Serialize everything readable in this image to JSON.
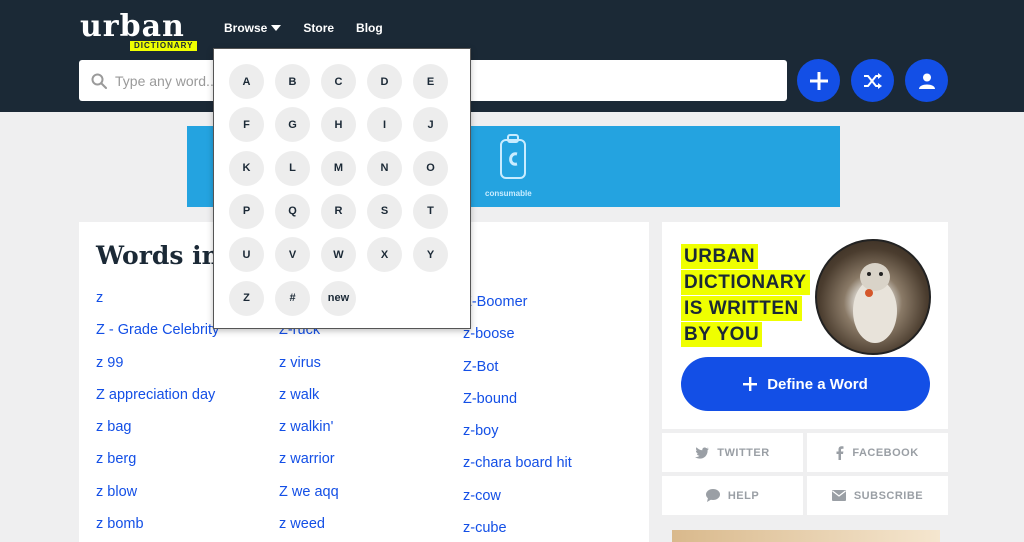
{
  "header": {
    "logo_main": "urban",
    "logo_sub": "DICTIONARY",
    "nav": [
      "Browse",
      "Store",
      "Blog"
    ],
    "search_placeholder": "Type any word..."
  },
  "ad": {
    "text": "consumable"
  },
  "main": {
    "title": "Words in",
    "columns": [
      [
        "z",
        "Z - Grade Celebrity",
        "z 99",
        "Z appreciation day",
        "z bag",
        "z berg",
        "z blow",
        "z bomb"
      ],
      [
        "",
        "Z-ruck",
        "z virus",
        "z walk",
        "z walkin'",
        "z warrior",
        "Z we aqq",
        "z weed"
      ],
      [
        "Z-Boomer",
        "z-boose",
        "Z-Bot",
        "Z-bound",
        "z-boy",
        "z-chara board hit",
        "z-cow",
        "z-cube"
      ]
    ]
  },
  "promo": {
    "text_lines": [
      "URBAN",
      "DICTIONARY",
      "IS WRITTEN",
      "BY YOU"
    ],
    "define_label": "Define a Word"
  },
  "social": {
    "twitter": "TWITTER",
    "facebook": "FACEBOOK",
    "help": "HELP",
    "subscribe": "SUBSCRIBE"
  },
  "dropdown": {
    "letters": [
      "A",
      "B",
      "C",
      "D",
      "E",
      "F",
      "G",
      "H",
      "I",
      "J",
      "K",
      "L",
      "M",
      "N",
      "O",
      "P",
      "Q",
      "R",
      "S",
      "T",
      "U",
      "V",
      "W",
      "X",
      "Y",
      "Z",
      "#",
      "new"
    ]
  },
  "colors": {
    "navy": "#1b2936",
    "accent_blue": "#134fe6",
    "highlight_yellow": "#efff00",
    "ad_blue": "#24a3e0"
  }
}
